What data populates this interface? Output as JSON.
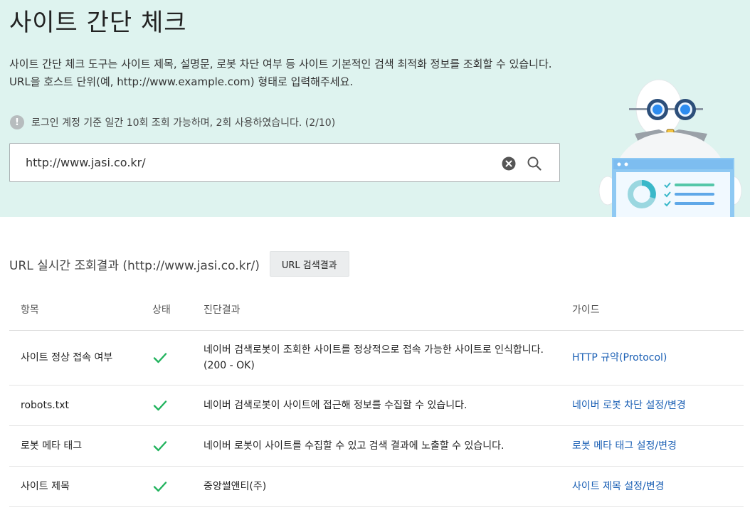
{
  "hero": {
    "title": "사이트 간단 체크",
    "description_line1": "사이트 간단 체크 도구는 사이트 제목, 설명문, 로봇 차단 여부 등 사이트 기본적인 검색 최적화 정보를 조회할 수 있습니다.",
    "description_line2": "URL을 호스트 단위(예, http://www.example.com) 형태로 입력해주세요.",
    "notice_icon": "!",
    "notice": "로그인 계정 기준 일간 10회 조회 가능하며, 2회 사용하였습니다. (2/10)"
  },
  "search": {
    "value": "http://www.jasi.co.kr/"
  },
  "results": {
    "title": "URL 실시간 조회결과 (http://www.jasi.co.kr/)",
    "url_search_button": "URL 검색결과",
    "headers": {
      "item": "항목",
      "status": "상태",
      "result": "진단결과",
      "guide": "가이드"
    },
    "rows": [
      {
        "item": "사이트 정상 접속 여부",
        "status": "check",
        "result": "네이버 검색로봇이 조회한 사이트를 정상적으로 접속 가능한 사이트로 인식합니다.",
        "result_line2": "(200 - OK)",
        "guide": "HTTP 규약(Protocol)"
      },
      {
        "item": "robots.txt",
        "status": "check",
        "result": "네이버 검색로봇이 사이트에 접근해 정보를 수집할 수 있습니다.",
        "guide": "네이버 로봇 차단 설정/변경"
      },
      {
        "item": "로봇 메타 태그",
        "status": "check",
        "result": "네이버 로봇이 사이트를 수집할 수 있고 검색 결과에 노출할 수 있습니다.",
        "guide": "로봇 메타 태그 설정/변경"
      },
      {
        "item": "사이트 제목",
        "status": "check",
        "result": "중앙썰앤티(주)",
        "guide": "사이트 제목 설정/변경"
      }
    ]
  },
  "colors": {
    "hero_background": "#def3ef",
    "check_green": "#22b35e",
    "link_blue": "#1a5fb4"
  },
  "icons": {
    "clear": "clear-icon",
    "search": "search-icon",
    "notice": "exclamation-icon",
    "status": "check-icon",
    "illustration": "robot-illustration"
  }
}
